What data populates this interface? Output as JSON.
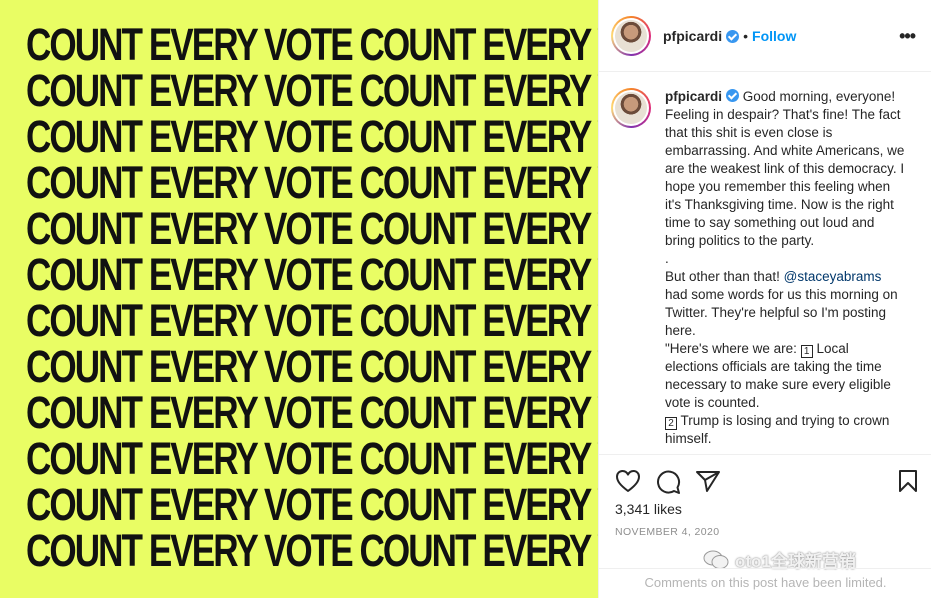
{
  "image": {
    "background_color": "#e9fd64",
    "text_color": "#111111",
    "lines": [
      "COUNT EVERY VOTE COUNT EVERY VOTE",
      "COUNT EVERY VOTE COUNT EVERY VOTE",
      "COUNT EVERY VOTE COUNT EVERY VOTE",
      "COUNT EVERY VOTE COUNT EVERY VOTE",
      "COUNT EVERY VOTE COUNT EVERY VOTE",
      "COUNT EVERY VOTE COUNT EVERY VOTE",
      "COUNT EVERY VOTE COUNT EVERY VOTE",
      "COUNT EVERY VOTE COUNT EVERY VOTE",
      "COUNT EVERY VOTE COUNT EVERY VOTE",
      "COUNT EVERY VOTE COUNT EVERY VOTE",
      "COUNT EVERY VOTE COUNT EVERY VOTE",
      "COUNT EVERY VOTE COUNT EVERY VOTE"
    ]
  },
  "header": {
    "username": "pfpicardi",
    "separator": "•",
    "follow_label": "Follow",
    "more_icon": "more-horizontal-icon"
  },
  "caption": {
    "username": "pfpicardi",
    "p1": "Good morning, everyone! Feeling in despair? That's fine! The fact that this shit is even close is embarrassing. And white Americans, we are the weakest link of this democracy. I hope you remember this feeling when it's Thanksgiving time. Now is the right time to say something out loud and bring politics to the party.",
    "dot_line": ".",
    "p2_prefix": "But other than that!",
    "mention": "@staceyabrams",
    "p2_suffix": "had some words for us this morning on Twitter. They're helpful so I'm posting here.",
    "p3_prefix": "\"Here's where we are:",
    "box1": "1",
    "p3_suffix": "Local elections officials are taking the time necessary to make sure every eligible vote is counted.",
    "box2": "2",
    "p4_suffix": "Trump is losing and trying to crown himself."
  },
  "actions": {
    "like_icon": "heart-icon",
    "comment_icon": "comment-icon",
    "share_icon": "paper-plane-icon",
    "save_icon": "bookmark-icon",
    "likes_text": "3,341 likes",
    "date_text": "NOVEMBER 4, 2020",
    "comments_limited_text": "Comments on this post have been limited."
  },
  "watermark": {
    "text": "oto1全球新营销",
    "icon": "wechat-icon"
  },
  "colors": {
    "accent": "#0095f6",
    "verified": "#3897f0",
    "muted": "#8e8e8e"
  }
}
